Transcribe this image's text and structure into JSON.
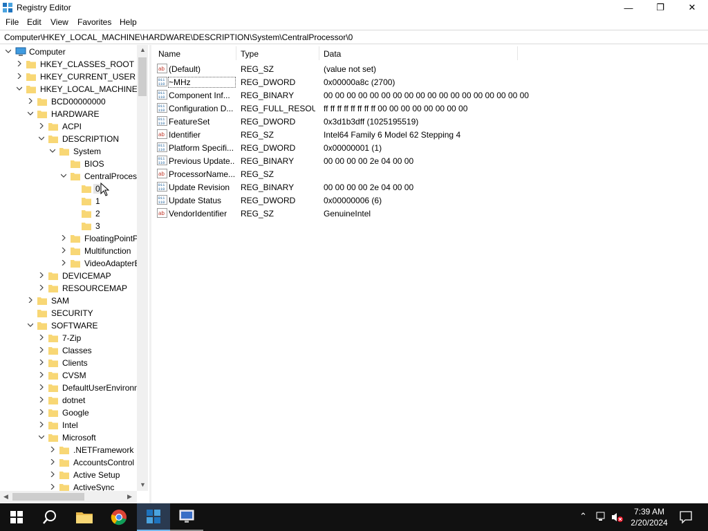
{
  "window": {
    "title": "Registry Editor",
    "minimize": "—",
    "maximize": "❐",
    "close": "✕"
  },
  "menu": [
    "File",
    "Edit",
    "View",
    "Favorites",
    "Help"
  ],
  "address": "Computer\\HKEY_LOCAL_MACHINE\\HARDWARE\\DESCRIPTION\\System\\CentralProcessor\\0",
  "tree": [
    {
      "label": "Computer",
      "icon": "computer-icon",
      "chevron": "expanded"
    },
    {
      "label": "HKEY_CLASSES_ROOT",
      "icon": "folder-icon",
      "chevron": "collapsed"
    },
    {
      "label": "HKEY_CURRENT_USER",
      "icon": "folder-icon",
      "chevron": "collapsed"
    },
    {
      "label": "HKEY_LOCAL_MACHINE",
      "icon": "folder-icon",
      "chevron": "expanded"
    },
    {
      "label": "BCD00000000",
      "icon": "folder-icon",
      "chevron": "collapsed"
    },
    {
      "label": "HARDWARE",
      "icon": "folder-icon",
      "chevron": "expanded"
    },
    {
      "label": "ACPI",
      "icon": "folder-icon",
      "chevron": "collapsed"
    },
    {
      "label": "DESCRIPTION",
      "icon": "folder-icon",
      "chevron": "expanded"
    },
    {
      "label": "System",
      "icon": "folder-icon",
      "chevron": "expanded"
    },
    {
      "label": "BIOS",
      "icon": "folder-icon",
      "chevron": "none"
    },
    {
      "label": "CentralProcess",
      "icon": "folder-icon",
      "chevron": "expanded"
    },
    {
      "label": "0",
      "icon": "folder-icon",
      "chevron": "none",
      "selected": true
    },
    {
      "label": "1",
      "icon": "folder-icon",
      "chevron": "none"
    },
    {
      "label": "2",
      "icon": "folder-icon",
      "chevron": "none"
    },
    {
      "label": "3",
      "icon": "folder-icon",
      "chevron": "none"
    },
    {
      "label": "FloatingPointP",
      "icon": "folder-icon",
      "chevron": "collapsed"
    },
    {
      "label": "Multifunction",
      "icon": "folder-icon",
      "chevron": "collapsed"
    },
    {
      "label": "VideoAdapterB",
      "icon": "folder-icon",
      "chevron": "collapsed"
    },
    {
      "label": "DEVICEMAP",
      "icon": "folder-icon",
      "chevron": "collapsed"
    },
    {
      "label": "RESOURCEMAP",
      "icon": "folder-icon",
      "chevron": "collapsed"
    },
    {
      "label": "SAM",
      "icon": "folder-icon",
      "chevron": "collapsed"
    },
    {
      "label": "SECURITY",
      "icon": "folder-icon",
      "chevron": "none"
    },
    {
      "label": "SOFTWARE",
      "icon": "folder-icon",
      "chevron": "expanded"
    },
    {
      "label": "7-Zip",
      "icon": "folder-icon",
      "chevron": "collapsed"
    },
    {
      "label": "Classes",
      "icon": "folder-icon",
      "chevron": "collapsed"
    },
    {
      "label": "Clients",
      "icon": "folder-icon",
      "chevron": "collapsed"
    },
    {
      "label": "CVSM",
      "icon": "folder-icon",
      "chevron": "collapsed"
    },
    {
      "label": "DefaultUserEnvironm",
      "icon": "folder-icon",
      "chevron": "collapsed"
    },
    {
      "label": "dotnet",
      "icon": "folder-icon",
      "chevron": "collapsed"
    },
    {
      "label": "Google",
      "icon": "folder-icon",
      "chevron": "collapsed"
    },
    {
      "label": "Intel",
      "icon": "folder-icon",
      "chevron": "collapsed"
    },
    {
      "label": "Microsoft",
      "icon": "folder-icon",
      "chevron": "expanded"
    },
    {
      "label": ".NETFramework",
      "icon": "folder-icon",
      "chevron": "collapsed"
    },
    {
      "label": "AccountsControl",
      "icon": "folder-icon",
      "chevron": "collapsed"
    },
    {
      "label": "Active Setup",
      "icon": "folder-icon",
      "chevron": "collapsed"
    },
    {
      "label": "ActiveSync",
      "icon": "folder-icon",
      "chevron": "collapsed"
    }
  ],
  "list": {
    "headers": {
      "name": "Name",
      "type": "Type",
      "data": "Data"
    },
    "rows": [
      {
        "icon": "string-value-icon",
        "name": "(Default)",
        "type": "REG_SZ",
        "data": "(value not set)"
      },
      {
        "icon": "binary-value-icon",
        "name": "~MHz",
        "type": "REG_DWORD",
        "data": "0x00000a8c (2700)",
        "focused": true
      },
      {
        "icon": "binary-value-icon",
        "name": "Component Inf...",
        "type": "REG_BINARY",
        "data": "00 00 00 00 00 00 00 00 00 00 00 00 00 00 00 00 00 00"
      },
      {
        "icon": "binary-value-icon",
        "name": "Configuration D...",
        "type": "REG_FULL_RESOU...",
        "data": "ff ff ff ff ff ff ff ff 00 00 00 00 00 00 00 00"
      },
      {
        "icon": "binary-value-icon",
        "name": "FeatureSet",
        "type": "REG_DWORD",
        "data": "0x3d1b3dff (1025195519)"
      },
      {
        "icon": "string-value-icon",
        "name": "Identifier",
        "type": "REG_SZ",
        "data": "Intel64 Family 6 Model 62 Stepping 4"
      },
      {
        "icon": "binary-value-icon",
        "name": "Platform Specifi...",
        "type": "REG_DWORD",
        "data": "0x00000001 (1)"
      },
      {
        "icon": "binary-value-icon",
        "name": "Previous Update...",
        "type": "REG_BINARY",
        "data": "00 00 00 00 2e 04 00 00"
      },
      {
        "icon": "string-value-icon",
        "name": "ProcessorName...",
        "type": "REG_SZ",
        "data": ""
      },
      {
        "icon": "binary-value-icon",
        "name": "Update Revision",
        "type": "REG_BINARY",
        "data": "00 00 00 00 2e 04 00 00"
      },
      {
        "icon": "binary-value-icon",
        "name": "Update Status",
        "type": "REG_DWORD",
        "data": "0x00000006 (6)"
      },
      {
        "icon": "string-value-icon",
        "name": "VendorIdentifier",
        "type": "REG_SZ",
        "data": "GenuineIntel"
      }
    ]
  },
  "taskbar": {
    "apps": [
      "start-icon",
      "search-icon",
      "file-explorer-icon",
      "chrome-icon",
      "registry-editor-icon",
      "remote-desktop-icon"
    ],
    "time": "7:39 AM",
    "date": "2/20/2024"
  },
  "colors": {
    "folder": "#f8d775",
    "accent": "#76b9ed",
    "taskbar": "#111111"
  }
}
